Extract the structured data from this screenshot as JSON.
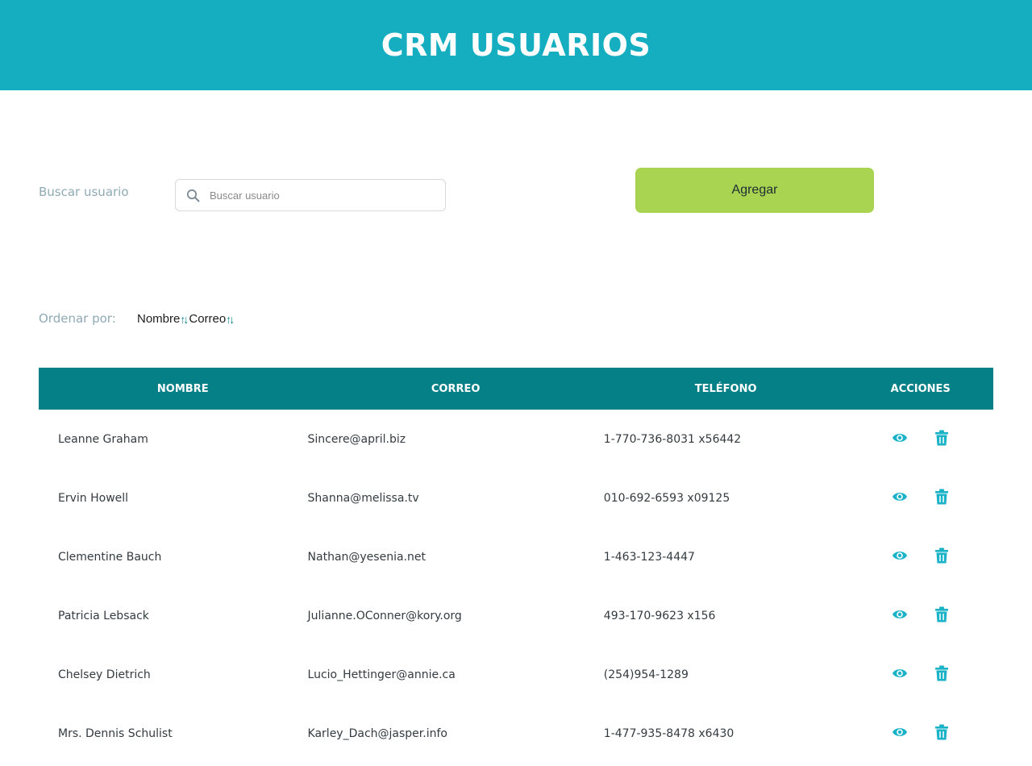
{
  "header": {
    "title": "CRM USUARIOS"
  },
  "search": {
    "label": "Buscar usuario",
    "placeholder": "Buscar usuario",
    "value": ""
  },
  "add_button": {
    "label": "Agregar"
  },
  "sort": {
    "label": "Ordenar por:",
    "options": [
      {
        "label": "Nombre",
        "icon": "sort-arrows-icon"
      },
      {
        "label": "Correo",
        "icon": "sort-arrows-icon"
      }
    ],
    "arrows": "↑↓"
  },
  "table": {
    "headers": {
      "name": "NOMBRE",
      "email": "CORREO",
      "phone": "TELÉFONO",
      "actions": "ACCIONES"
    },
    "rows": [
      {
        "name": "Leanne Graham",
        "email": "Sincere@april.biz",
        "phone": "1-770-736-8031 x56442"
      },
      {
        "name": "Ervin Howell",
        "email": "Shanna@melissa.tv",
        "phone": "010-692-6593 x09125"
      },
      {
        "name": "Clementine Bauch",
        "email": "Nathan@yesenia.net",
        "phone": "1-463-123-4447"
      },
      {
        "name": "Patricia Lebsack",
        "email": "Julianne.OConner@kory.org",
        "phone": "493-170-9623 x156"
      },
      {
        "name": "Chelsey Dietrich",
        "email": "Lucio_Hettinger@annie.ca",
        "phone": "(254)954-1289"
      },
      {
        "name": "Mrs. Dennis Schulist",
        "email": "Karley_Dach@jasper.info",
        "phone": "1-477-935-8478 x6430"
      }
    ],
    "row_actions": [
      {
        "icon": "eye-icon"
      },
      {
        "icon": "trash-icon"
      }
    ]
  },
  "colors": {
    "header_bg": "#15aec1",
    "table_header_bg": "#068087",
    "accent": "#1ab2c6",
    "add_button_bg": "#a9d451",
    "muted_label": "#8faab5"
  }
}
